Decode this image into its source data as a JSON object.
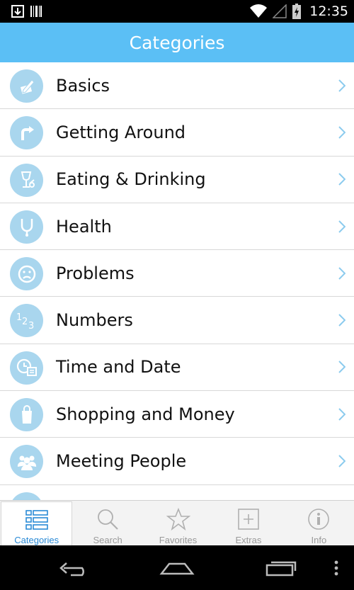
{
  "status_bar": {
    "time": "12:35"
  },
  "header": {
    "title": "Categories"
  },
  "categories": [
    {
      "label": "Basics",
      "icon": "pencil-paper-icon"
    },
    {
      "label": "Getting Around",
      "icon": "turn-right-arrow-icon"
    },
    {
      "label": "Eating & Drinking",
      "icon": "wine-glass-icon"
    },
    {
      "label": "Health",
      "icon": "stethoscope-icon"
    },
    {
      "label": "Problems",
      "icon": "sad-face-icon"
    },
    {
      "label": "Numbers",
      "icon": "numbers-123-icon"
    },
    {
      "label": "Time and Date",
      "icon": "clock-calendar-icon"
    },
    {
      "label": "Shopping and Money",
      "icon": "shopping-bag-icon"
    },
    {
      "label": "Meeting People",
      "icon": "people-group-icon"
    }
  ],
  "tabs": [
    {
      "label": "Categories",
      "icon": "list-icon",
      "active": true
    },
    {
      "label": "Search",
      "icon": "search-icon",
      "active": false
    },
    {
      "label": "Favorites",
      "icon": "star-icon",
      "active": false
    },
    {
      "label": "Extras",
      "icon": "plus-box-icon",
      "active": false
    },
    {
      "label": "Info",
      "icon": "info-icon",
      "active": false
    }
  ],
  "colors": {
    "accent": "#5bbff5",
    "icon_circle": "#a9d6ee",
    "active_tab": "#2a8ad6",
    "inactive_tab": "#9a9a9a"
  }
}
